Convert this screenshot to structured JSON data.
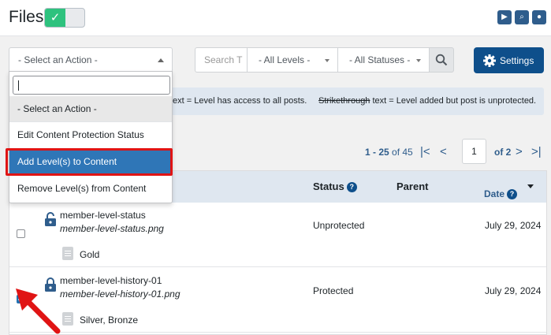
{
  "header": {
    "title": "Files",
    "toggle_state": "on",
    "icons": [
      "play-icon",
      "search-doc-icon",
      "user-icon"
    ]
  },
  "toolbar": {
    "action_select": "- Select an Action -",
    "search_placeholder": "Search T",
    "levels_select": "- All Levels -",
    "statuses_select": "- All Statuses -",
    "settings_label": "Settings"
  },
  "legend": {
    "text1": "text = Level has access to all posts.",
    "text2_strike": "Strikethrough",
    "text2_rest": " text = Level added but post is unprotected."
  },
  "pagination": {
    "range": "1 - 25",
    "of_total": "of 45",
    "page": "1",
    "of_pages": "of 2"
  },
  "table": {
    "columns": {
      "status": "Status",
      "parent": "Parent",
      "date": "Date"
    },
    "rows": [
      {
        "name": "member-level-status",
        "filename": "member-level-status.png",
        "levels": "Gold",
        "status": "Unprotected",
        "date": "July 29, 2024",
        "checked": false
      },
      {
        "name": "member-level-history-01",
        "filename": "member-level-history-01.png",
        "levels": "Silver, Bronze",
        "status": "Protected",
        "date": "July 29, 2024",
        "checked": true
      }
    ]
  },
  "dropdown": {
    "items": [
      "- Select an Action -",
      "Edit Content Protection Status",
      "Add Level(s) to Content",
      "Remove Level(s) from Content"
    ],
    "highlighted_index": 2
  },
  "colors": {
    "primary": "#0e4f8b",
    "link": "#2f5d8c",
    "toggle_on": "#2ec27e",
    "highlight": "#2f76b7",
    "annotation": "#e01414"
  }
}
